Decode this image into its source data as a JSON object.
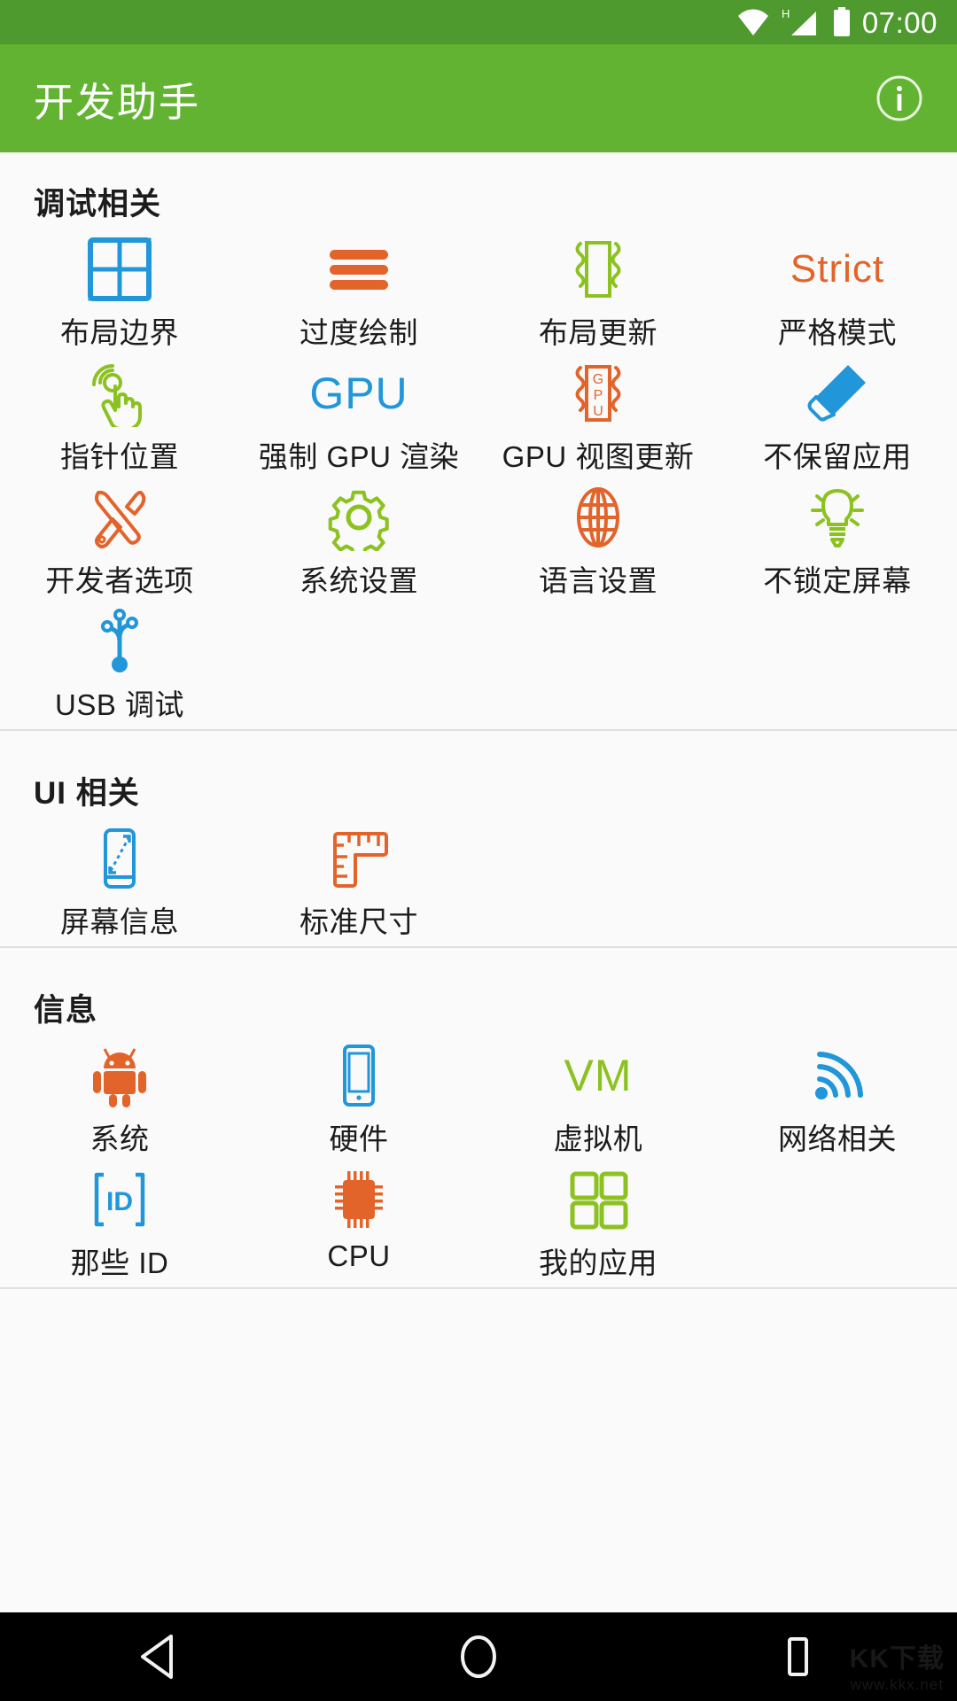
{
  "status_bar": {
    "time": "07:00",
    "icons": [
      "wifi-icon",
      "signal-h-icon",
      "battery-icon"
    ],
    "background": "#4e9a2f"
  },
  "app_bar": {
    "title": "开发助手",
    "info_icon": "info-icon",
    "background": "#63b333"
  },
  "colors": {
    "blue": "#2196d9",
    "orange": "#e2642a",
    "green": "#8bc220",
    "text": "#1c1c1c",
    "page_bg": "#fafafa",
    "divider": "#e0e0e0"
  },
  "sections": [
    {
      "title": "调试相关",
      "items": [
        {
          "label": "布局边界",
          "icon": "layout-bounds-icon",
          "color": "#2196d9"
        },
        {
          "label": "过度绘制",
          "icon": "overdraw-lines-icon",
          "color": "#e2642a"
        },
        {
          "label": "布局更新",
          "icon": "layout-update-icon",
          "color": "#8bc220"
        },
        {
          "label": "严格模式",
          "icon": "strict-mode-icon",
          "color": "#e2642a",
          "glyph": "Strict"
        },
        {
          "label": "指针位置",
          "icon": "pointer-location-icon",
          "color": "#8bc220"
        },
        {
          "label": "强制 GPU 渲染",
          "icon": "gpu-render-icon",
          "color": "#2196d9",
          "glyph": "GPU"
        },
        {
          "label": "GPU 视图更新",
          "icon": "gpu-view-update-icon",
          "color": "#e2642a"
        },
        {
          "label": "不保留应用",
          "icon": "eraser-icon",
          "color": "#2196d9"
        },
        {
          "label": "开发者选项",
          "icon": "tools-icon",
          "color": "#e2642a"
        },
        {
          "label": "系统设置",
          "icon": "gear-icon",
          "color": "#8bc220"
        },
        {
          "label": "语言设置",
          "icon": "globe-icon",
          "color": "#e2642a"
        },
        {
          "label": "不锁定屏幕",
          "icon": "lightbulb-icon",
          "color": "#8bc220"
        },
        {
          "label": "USB 调试",
          "icon": "usb-icon",
          "color": "#2196d9"
        }
      ]
    },
    {
      "title": "UI 相关",
      "items": [
        {
          "label": "屏幕信息",
          "icon": "screen-info-icon",
          "color": "#2196d9"
        },
        {
          "label": "标准尺寸",
          "icon": "ruler-icon",
          "color": "#e2642a"
        }
      ]
    },
    {
      "title": "信息",
      "items": [
        {
          "label": "系统",
          "icon": "android-robot-icon",
          "color": "#e2642a"
        },
        {
          "label": "硬件",
          "icon": "phone-icon",
          "color": "#2196d9"
        },
        {
          "label": "虚拟机",
          "icon": "vm-icon",
          "color": "#8bc220",
          "glyph": "VM"
        },
        {
          "label": "网络相关",
          "icon": "wifi-signal-icon",
          "color": "#2196d9"
        },
        {
          "label": "那些 ID",
          "icon": "id-card-icon",
          "color": "#2196d9",
          "glyph": "ID"
        },
        {
          "label": "CPU",
          "icon": "cpu-chip-icon",
          "color": "#e2642a"
        },
        {
          "label": "我的应用",
          "icon": "apps-grid-icon",
          "color": "#8bc220"
        }
      ]
    }
  ],
  "nav_bar": {
    "back": "back-triangle-icon",
    "home": "home-circle-icon",
    "recents": "recents-square-icon"
  },
  "watermark": {
    "main": "KK下载",
    "sub": "www.kkx.net"
  }
}
